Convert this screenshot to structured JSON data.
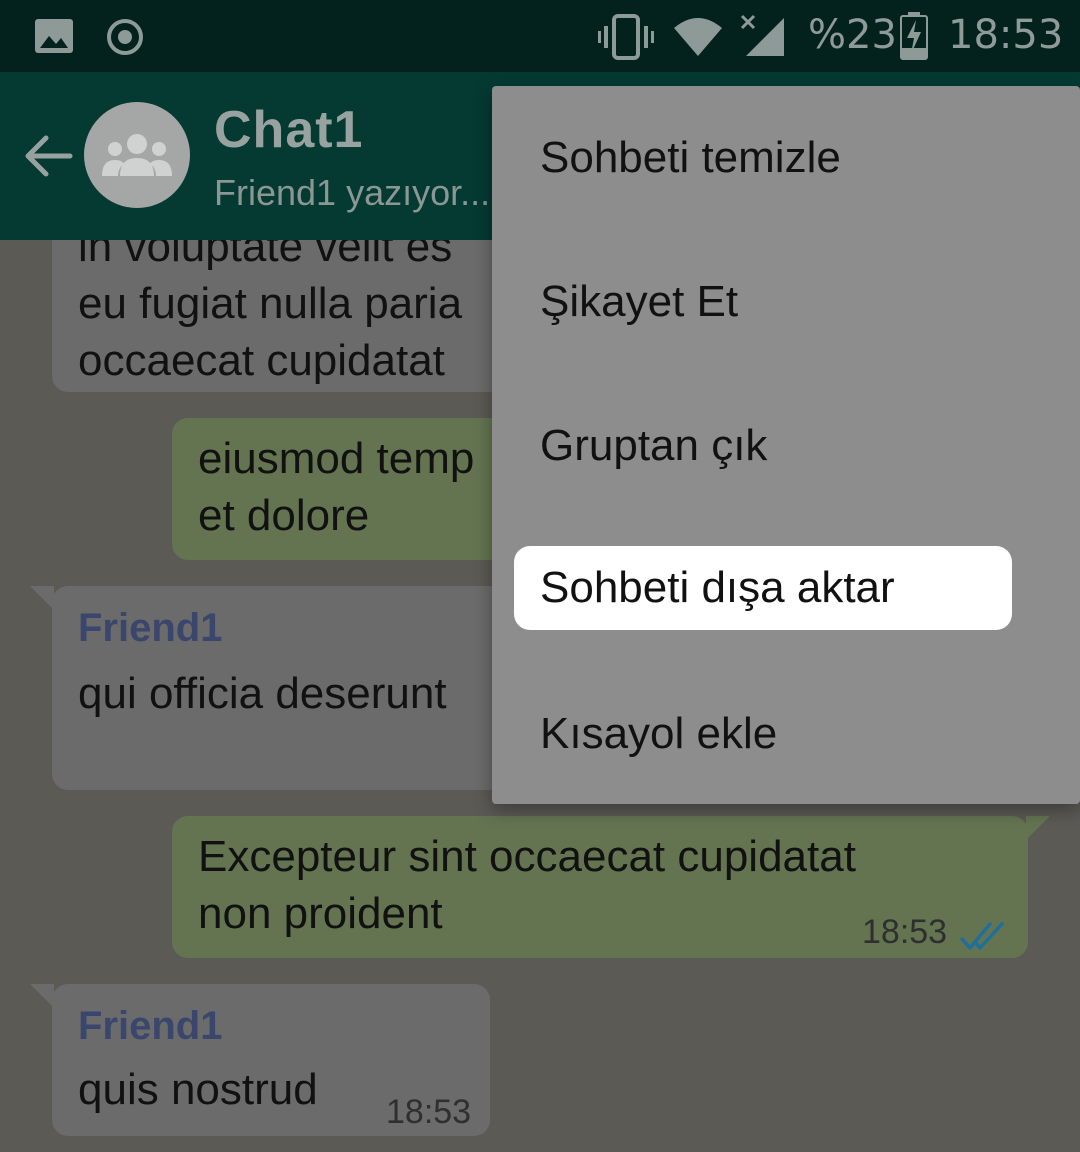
{
  "status_bar": {
    "battery": "%23",
    "time": "18:53",
    "icons": [
      "image-icon",
      "target-icon",
      "vibrate-icon",
      "wifi-icon",
      "signal-icon",
      "battery-charging-icon"
    ]
  },
  "header": {
    "title": "Chat1",
    "subtitle": "Friend1 yazıyor..."
  },
  "messages": [
    {
      "type": "in",
      "lines": [
        "in voluptate velit es",
        "eu fugiat nulla paria",
        "occaecat cupidatat"
      ]
    },
    {
      "type": "out",
      "lines": [
        "eiusmod temp",
        "et dolore"
      ]
    },
    {
      "type": "in",
      "sender": "Friend1",
      "lines": [
        "qui officia deserunt"
      ]
    },
    {
      "type": "out",
      "lines": [
        "Excepteur sint occaecat cupidatat",
        "non proident"
      ],
      "time": "18:53"
    },
    {
      "type": "in",
      "sender": "Friend1",
      "lines": [
        "quis nostrud"
      ],
      "time": "18:53"
    }
  ],
  "menu": {
    "items": [
      {
        "label": "Sohbeti temizle"
      },
      {
        "label": "Şikayet Et"
      },
      {
        "label": "Gruptan çık"
      },
      {
        "label": "Sohbeti dışa aktar",
        "highlighted": true
      },
      {
        "label": "Kısayol ekle"
      }
    ]
  },
  "colors": {
    "header": "#043a32",
    "status_bar": "#03211d",
    "outgoing_bubble": "#647451",
    "incoming_bubble": "#6b6b6b",
    "read_ticks": "#1f6f9c"
  }
}
